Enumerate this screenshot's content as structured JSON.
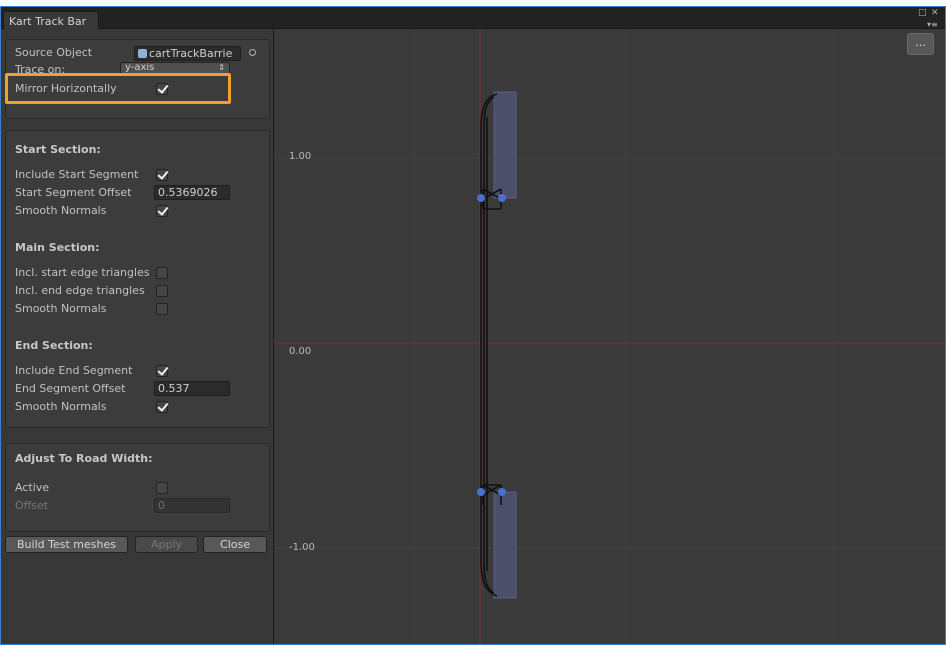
{
  "window": {
    "tab_title": "Kart Track Bar"
  },
  "source": {
    "source_object_label": "Source Object",
    "source_object_value": "cartTrackBarrie",
    "trace_on_label": "Trace on:",
    "trace_on_value": "y-axis",
    "mirror_label": "Mirror Horizontally",
    "mirror_checked": true
  },
  "start_section": {
    "header": "Start Section:",
    "include_label": "Include Start Segment",
    "include_checked": true,
    "offset_label": "Start Segment Offset",
    "offset_value": "0.5369026",
    "smooth_label": "Smooth Normals",
    "smooth_checked": true
  },
  "main_section": {
    "header": "Main Section:",
    "start_edge_label": "Incl. start edge triangles",
    "start_edge_checked": false,
    "end_edge_label": "Incl. end edge triangles",
    "end_edge_checked": false,
    "smooth_label": "Smooth Normals",
    "smooth_checked": false
  },
  "end_section": {
    "header": "End Section:",
    "include_label": "Include End Segment",
    "include_checked": true,
    "offset_label": "End Segment Offset",
    "offset_value": "0.537",
    "smooth_label": "Smooth Normals",
    "smooth_checked": true
  },
  "road_width": {
    "header": "Adjust To Road Width:",
    "active_label": "Active",
    "active_checked": false,
    "offset_label": "Offset",
    "offset_value": "0"
  },
  "buttons": {
    "build": "Build Test meshes",
    "apply": "Apply",
    "close": "Close"
  },
  "viewport": {
    "more_label": "...",
    "axis_labels": {
      "top": "1.00",
      "middle": "0.00",
      "bottom": "-1.00"
    }
  },
  "colors": {
    "highlight": "#f0a030",
    "axis_line": "#8a2a2a",
    "point": "#4a6fd0",
    "segment_fill": "#4c4f6a"
  }
}
